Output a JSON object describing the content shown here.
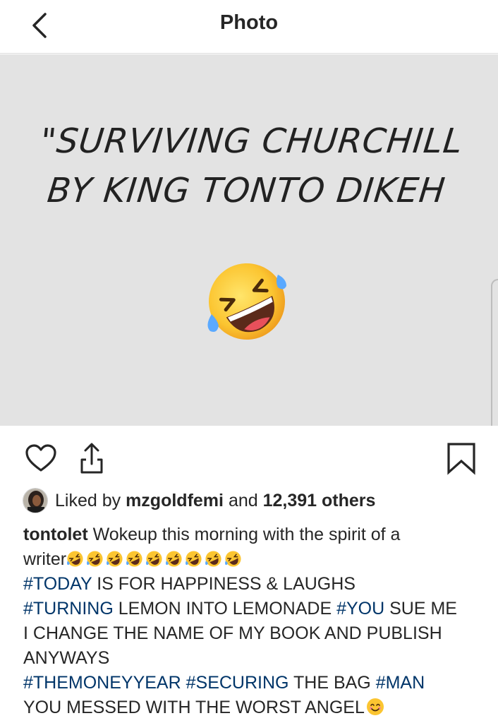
{
  "topbar": {
    "title": "Photo"
  },
  "photo": {
    "line1": "\"SURVIVING CHURCHILL",
    "line2": "BY KING TONTO DIKEH",
    "emoji": "rolling-on-floor-laughing-emoji"
  },
  "actions": {
    "icons": [
      "heart-icon",
      "share-icon",
      "bookmark-icon"
    ]
  },
  "likes": {
    "prefix": "Liked by",
    "user": "mzgoldfemi",
    "middle": "and",
    "others": "12,391 others"
  },
  "caption": {
    "username": "tontolet",
    "line1_text": "Wokeup this morning with the spirit of a",
    "line2_text": "writer",
    "laugh_emoji_count": 9,
    "tag_today": "#TODAY",
    "text_today": "IS FOR HAPPINESS & LAUGHS",
    "tag_turning": "#TURNING",
    "text_turning": "LEMON INTO LEMONADE",
    "tag_you": "#YOU",
    "text_you": "SUE ME",
    "line5": "I CHANGE THE NAME OF MY BOOK AND PUBLISH",
    "line6": "ANYWAYS",
    "tag_moneyyear": "#THEMONEYYEAR",
    "tag_securing": "#SECURING",
    "text_securing": "THE BAG",
    "tag_man": "#MAN",
    "line8": "YOU MESSED WITH THE WORST ANGEL",
    "end_emoji": "smiling-face-emoji"
  },
  "colors": {
    "hashtag": "#003569",
    "photo_bg": "#e3e3e3",
    "text": "#262626"
  }
}
